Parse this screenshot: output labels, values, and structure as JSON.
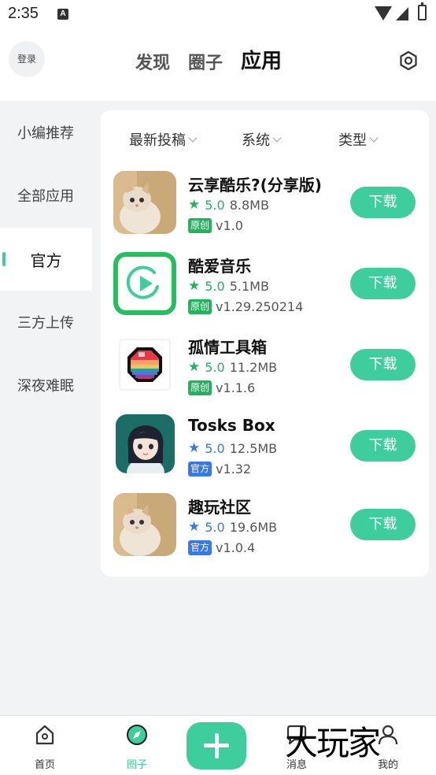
{
  "status_bar": {
    "time": "2:35",
    "notification_letter": "A"
  },
  "header": {
    "login_label": "登录",
    "tabs": [
      "发现",
      "圈子",
      "应用"
    ],
    "active_tab": "应用"
  },
  "sidebar": {
    "items": [
      "小编推荐",
      "全部应用",
      "官方",
      "三方上传",
      "深夜难眠"
    ],
    "active_item": "官方"
  },
  "filters": [
    "最新投稿",
    "系统",
    "类型"
  ],
  "apps": [
    {
      "name": "云享酷乐?(分享版)",
      "rating": "5.0",
      "size": "8.8MB",
      "badge": "原创",
      "version": "v1.0",
      "button": "下载",
      "icon": "cat-photo-icon",
      "star_color": "#21b45e",
      "badge_color": "#21b45e"
    },
    {
      "name": "酷爱音乐",
      "rating": "5.0",
      "size": "5.1MB",
      "badge": "原创",
      "version": "v1.29.250214",
      "button": "下载",
      "icon": "music-play-icon",
      "star_color": "#21b45e",
      "badge_color": "#21b45e"
    },
    {
      "name": "孤情工具箱",
      "rating": "5.0",
      "size": "11.2MB",
      "badge": "原创",
      "version": "v1.1.6",
      "button": "下载",
      "icon": "rainbow-gem-icon",
      "star_color": "#21b45e",
      "badge_color": "#21b45e"
    },
    {
      "name": "Tosks Box",
      "rating": "5.0",
      "size": "12.5MB",
      "badge": "官方",
      "version": "v1.32",
      "button": "下载",
      "icon": "anime-girl-icon",
      "star_color": "#3978e8",
      "badge_color": "#3978e8"
    },
    {
      "name": "趣玩社区",
      "rating": "5.0",
      "size": "19.6MB",
      "badge": "官方",
      "version": "v1.0.4",
      "button": "下载",
      "icon": "cat-photo-icon",
      "star_color": "#3978e8",
      "badge_color": "#3978e8"
    }
  ],
  "bottom_nav": {
    "items": [
      "首页",
      "圈子",
      "消息",
      "我的"
    ],
    "active_item": "圈子",
    "watermark": "大玩家"
  },
  "colors": {
    "accent": "#3ecd9c",
    "original_green": "#21b45e",
    "official_blue": "#3978e8"
  }
}
